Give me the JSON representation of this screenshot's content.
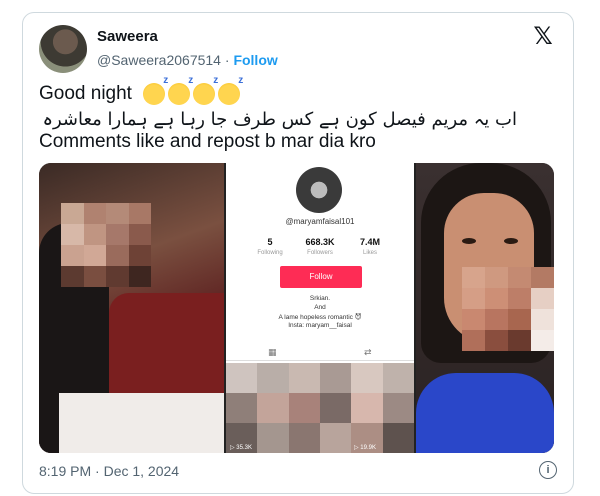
{
  "tweet": {
    "display_name": "Saweera",
    "handle": "@Saweera2067514",
    "separator": " · ",
    "follow_label": "Follow",
    "logo": "x-logo",
    "line1": "Good night",
    "emoji_name": "sleeping-face-emoji",
    "emoji_count": 4,
    "line2_urdu": "اب یہ مریم فیصل کون ہے کس طرف جا رہا ہے ہمارا معاشرہ",
    "line3": "Comments like and repost b mar dia kro",
    "timestamp": "8:19 PM · Dec 1, 2024",
    "info_icon": "info-icon"
  },
  "media": {
    "profile": {
      "username": "@maryamfaisal101",
      "stats": [
        {
          "value": "5",
          "label": "Following"
        },
        {
          "value": "668.3K",
          "label": "Followers"
        },
        {
          "value": "7.4M",
          "label": "Likes"
        }
      ],
      "follow_button": "Follow",
      "bio_lines": [
        "Srkian.",
        "And",
        "A lame hopeless romantic 😈",
        "Insta: maryam__faisal"
      ],
      "views": [
        "▷ 35.3K",
        "▷ 19.9K"
      ]
    }
  },
  "colors": {
    "accent": "#1d9bf0",
    "follow_button": "#fe2c55",
    "text_primary": "#0f1419",
    "text_secondary": "#536471"
  }
}
